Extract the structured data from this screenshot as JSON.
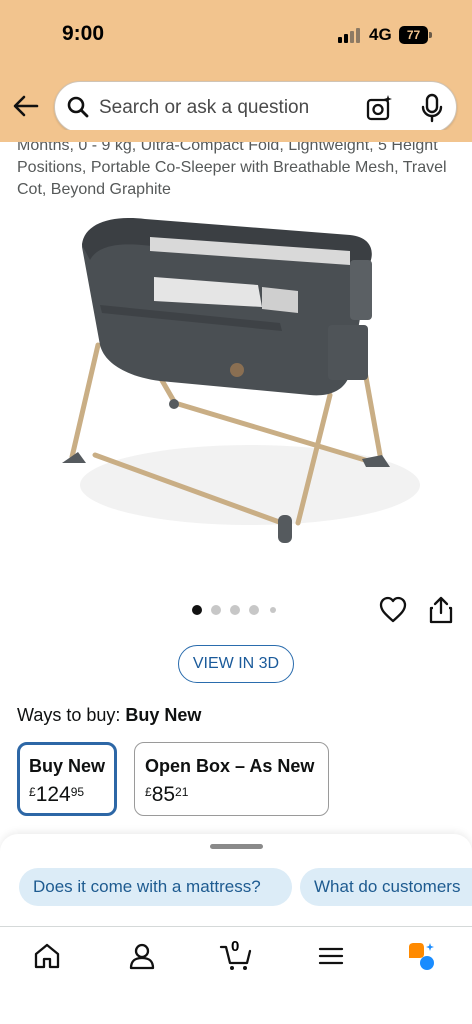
{
  "status_bar": {
    "time": "9:00",
    "network": "4G",
    "battery": "77"
  },
  "search": {
    "placeholder": "Search or ask a question"
  },
  "product": {
    "title": "Months, 0 - 9 kg, Ultra-Compact Fold, Lightweight, 5 Height Positions, Portable Co-Sleeper with Breathable Mesh, Travel Cot, Beyond Graphite",
    "image_count": 5,
    "active_image": 1
  },
  "view_in_3d": "VIEW IN 3D",
  "ways_to_buy": {
    "label": "Ways to buy:",
    "value": "Buy New"
  },
  "options": [
    {
      "name": "Buy New",
      "currency": "£",
      "whole": "124",
      "fraction": "95",
      "selected": true
    },
    {
      "name": "Open Box – As New",
      "currency": "£",
      "whole": "85",
      "fraction": "21",
      "selected": false
    }
  ],
  "suggestions": [
    "Does it come with a mattress?",
    "What do customers"
  ],
  "tabbar": {
    "cart_count": "0"
  },
  "colors": {
    "header": "#f2c48e",
    "link": "#1a5a9a",
    "selected_border": "#2d67a6",
    "chip_bg": "#dcecf7",
    "rufus_orange": "#ff8a00",
    "rufus_blue": "#1a8cff"
  }
}
